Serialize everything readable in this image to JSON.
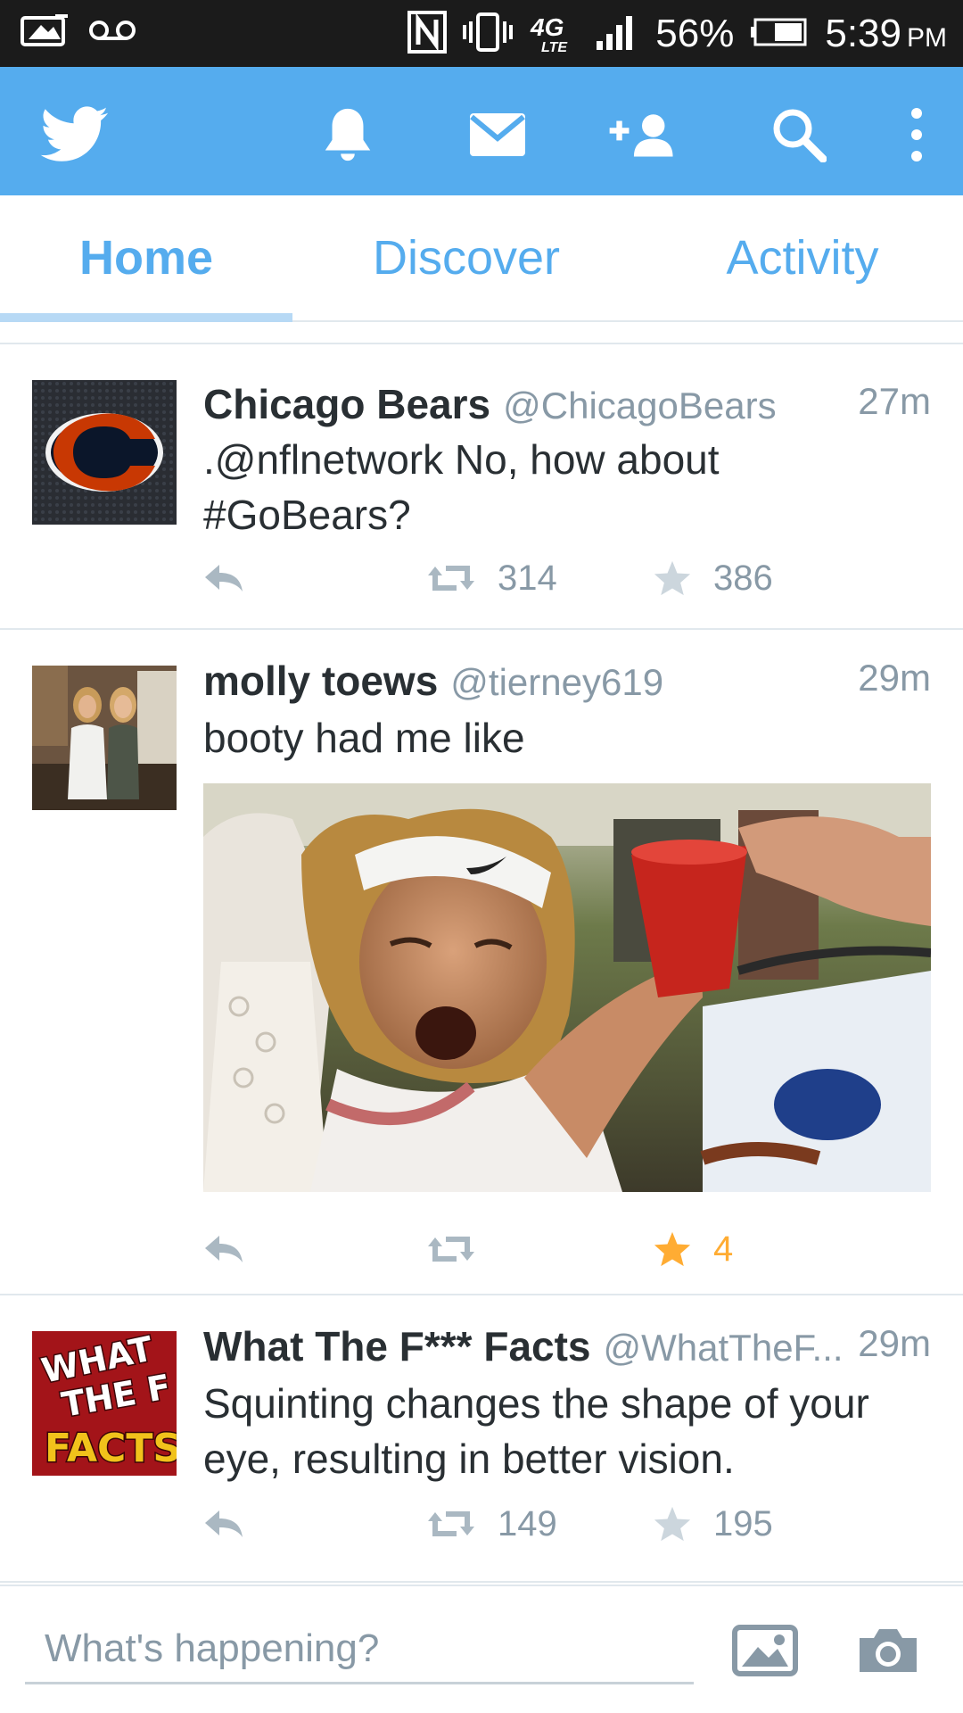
{
  "status_bar": {
    "battery_percent": "56%",
    "time": "5:39",
    "time_suffix": "PM",
    "network": "4G LTE",
    "icons": [
      "gallery-notify-icon",
      "voicemail-icon",
      "nfc-icon",
      "vibrate-icon",
      "4g-lte-icon",
      "signal-icon",
      "battery-icon"
    ]
  },
  "app_bar": {
    "icons": [
      "twitter-bird-icon",
      "notifications-bell-icon",
      "messages-envelope-icon",
      "add-user-icon",
      "search-icon",
      "overflow-menu-icon"
    ],
    "bar_color": "#55acee"
  },
  "tabs": [
    {
      "label": "Home",
      "active": true
    },
    {
      "label": "Discover",
      "active": false
    },
    {
      "label": "Activity",
      "active": false
    }
  ],
  "tweets": [
    {
      "name": "Chicago Bears",
      "handle": "@ChicagoBears",
      "time": "27m",
      "text_line1": ".@nflnetwork No, how about",
      "text_line2": "#GoBears?",
      "retweets": "314",
      "favorites": "386",
      "favorited": false,
      "avatar_icon": "chicago-bears-logo-icon"
    },
    {
      "name": "molly toews",
      "handle": "@tierney619",
      "time": "29m",
      "text_line1": "booty had me like",
      "retweets": "",
      "favorites": "4",
      "favorited": true,
      "has_media": true,
      "avatar_icon": "profile-photo-two-women"
    },
    {
      "name": "What The F*** Facts",
      "handle": "@WhatTheF...",
      "time": "29m",
      "text_line1": "Squinting changes the shape of your",
      "text_line2": "eye, resulting in better vision.",
      "retweets": "149",
      "favorites": "195",
      "favorited": false,
      "avatar_icon": "what-the-f-facts-logo-icon",
      "avatar_text": [
        "WHAT",
        "THE F",
        "FACTS"
      ]
    }
  ],
  "composer": {
    "placeholder": "What's happening?",
    "icons": [
      "image-icon",
      "camera-icon"
    ]
  },
  "colors": {
    "accent": "#55acee",
    "favorite": "#ffac33",
    "muted": "#8899a6"
  }
}
